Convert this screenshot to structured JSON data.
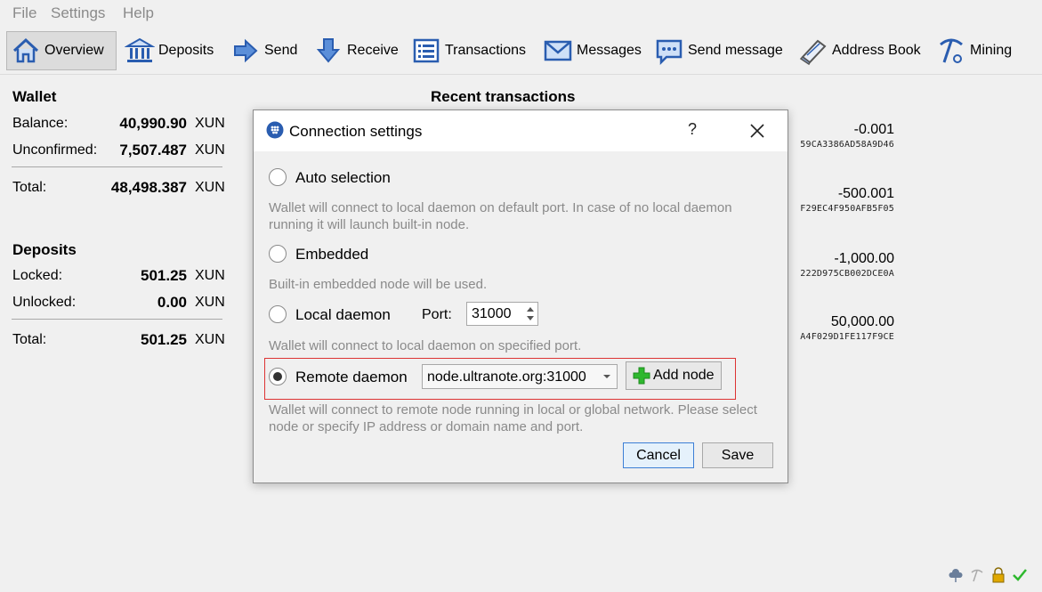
{
  "menu": [
    "File",
    "Settings",
    "Help"
  ],
  "toolbar": [
    {
      "label": "Overview",
      "icon": "home-icon",
      "active": true
    },
    {
      "label": "Deposits",
      "icon": "bank-icon"
    },
    {
      "label": "Send",
      "icon": "send-arrow-icon"
    },
    {
      "label": "Receive",
      "icon": "receive-arrow-icon"
    },
    {
      "label": "Transactions",
      "icon": "list-icon"
    },
    {
      "label": "Messages",
      "icon": "envelope-icon"
    },
    {
      "label": "Send message",
      "icon": "chat-bubble-icon"
    },
    {
      "label": "Address Book",
      "icon": "address-book-icon"
    },
    {
      "label": "Mining",
      "icon": "pickaxe-icon"
    }
  ],
  "wallet": {
    "title": "Wallet",
    "balance_label": "Balance:",
    "balance_value": "40,990.90",
    "balance_unit": "XUN",
    "unconfirmed_label": "Unconfirmed:",
    "unconfirmed_value": "7,507.487",
    "unconfirmed_unit": "XUN",
    "total_label": "Total:",
    "total_value": "48,498.387",
    "total_unit": "XUN"
  },
  "deposits": {
    "title": "Deposits",
    "locked_label": "Locked:",
    "locked_value": "501.25",
    "locked_unit": "XUN",
    "unlocked_label": "Unlocked:",
    "unlocked_value": "0.00",
    "unlocked_unit": "XUN",
    "total_label": "Total:",
    "total_value": "501.25",
    "total_unit": "XUN"
  },
  "recent": {
    "title": "Recent transactions",
    "items": [
      {
        "amount": "-0.001",
        "hash": "59CA3386AD58A9D46"
      },
      {
        "amount": "-500.001",
        "hash": "F29EC4F950AFB5F05"
      },
      {
        "amount": "-1,000.00",
        "hash": "222D975CB002DCE0A"
      },
      {
        "amount": "50,000.00",
        "hash": "A4F029D1FE117F9CE"
      }
    ]
  },
  "dialog": {
    "title": "Connection settings",
    "help": "?",
    "options": [
      {
        "label": "Auto selection",
        "desc": "Wallet will connect to local daemon on default port. In case of no local daemon running it will launch built-in node.",
        "checked": false
      },
      {
        "label": "Embedded",
        "desc": "Built-in embedded node will be used.",
        "checked": false
      },
      {
        "label": "Local daemon",
        "desc": "Wallet will connect to local daemon on specified port.",
        "checked": false
      },
      {
        "label": "Remote daemon",
        "desc": "Wallet will connect to remote node running in local or global network. Please select node or specify IP address or domain name and port.",
        "checked": true
      }
    ],
    "port_label": "Port:",
    "port_value": "31000",
    "remote_node": "node.ultranote.org:31000",
    "add_node_label": "Add node",
    "cancel_label": "Cancel",
    "save_label": "Save"
  },
  "colors": {
    "accent": "#3c7fd6",
    "highlight": "#dd3333",
    "add_green": "#2eb82e"
  }
}
